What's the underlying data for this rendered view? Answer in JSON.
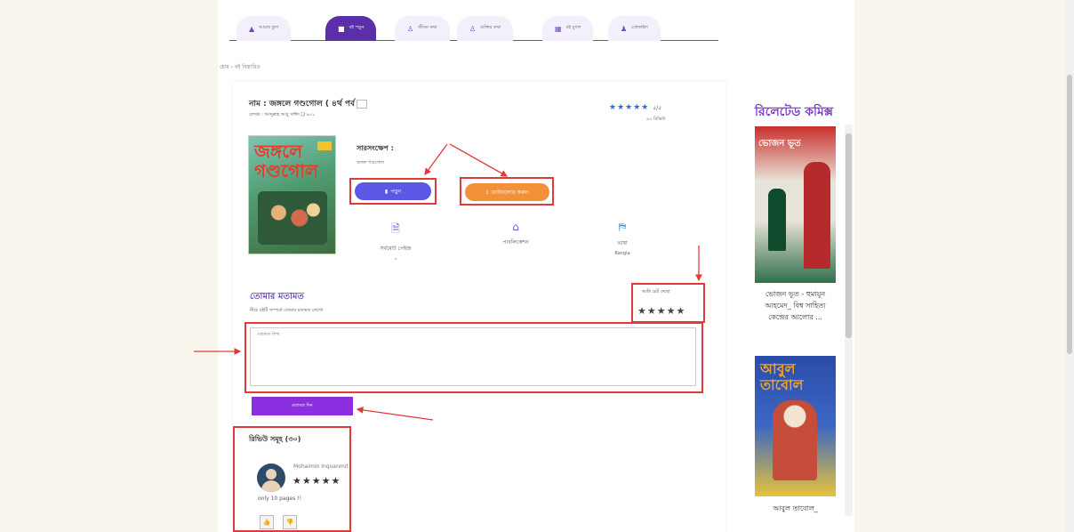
{
  "nav": {
    "tabs": [
      {
        "label": "আমার ঝুল",
        "icon": "home-icon"
      },
      {
        "label": "বই পড়ুন",
        "icon": "book-icon",
        "active": true
      },
      {
        "label": "জীবন কথা",
        "icon": "user-icon"
      },
      {
        "label": "ব্যক্তির কথা",
        "icon": "user-icon"
      },
      {
        "label": "বই যুগল",
        "icon": "grid-icon"
      },
      {
        "label": "প্রোফাইল",
        "icon": "person-icon"
      }
    ]
  },
  "breadcrumb": "হোম › বই বিস্তারিত",
  "book": {
    "title": "নাম : জঙ্গলে গণ্ডগোল ( ৪র্থ পর্ব",
    "writer": "লেখক : আব্দুল্লাহ আবু সাঈদ ❏ ৯০১",
    "rating_stars": "★★★★★",
    "rating_score": "৫/৫",
    "review_count": "৯০ রিভিউ",
    "cover_title": "জঙ্গলে গণ্ডগোল",
    "summary_label": "সারসংক্ষেপ :",
    "summary_text": "জঙ্গল গণ্ডগোল",
    "read_label": "পড়ুন",
    "download_label": "ডাউনলোড করুন",
    "info": [
      {
        "icon": "document-icon",
        "label": "সর্বমোট পেইজ",
        "sub": "০"
      },
      {
        "icon": "publisher-icon",
        "label": "পাবলিকেশন",
        "sub": ""
      },
      {
        "icon": "language-icon",
        "label": "ভাষা",
        "sub": "Bangla"
      }
    ]
  },
  "feedback": {
    "title": "তোমার মতামত",
    "hint": "নীচে বইটি সম্পর্কে তোমার মতামত লেখো",
    "your_rating_label": "আমি রেট দেবো",
    "your_stars": "★★★★★",
    "comment_placeholder": "মতামত লিখ",
    "submit_label": "মতামত দিন"
  },
  "reviews": {
    "title": "রিভিউ সমূহ (৩০)",
    "items": [
      {
        "name": "Mohaimin Inquanmit",
        "stars": "★★★★★",
        "text": "only 10 pages !!"
      }
    ],
    "like_label": "👍",
    "dislike_label": "👎"
  },
  "related": {
    "title": "রিলেটেড কমিক্স",
    "items": [
      {
        "cover_title": "ভোজন ভূত",
        "title": "ভোজন ভূত - হুমায়ূন আহমেদ_ বিশ্ব সাহিত্য কেন্দ্রের আলোর ..."
      },
      {
        "cover_title": "আবুল তাবোল",
        "title": "আবুল তাবোল_"
      }
    ]
  },
  "colors": {
    "accent": "#6b45c7",
    "read_button": "#5c58e6",
    "download_button": "#f2913a",
    "submit_button": "#8b2fe0",
    "annotation": "#e23a3a"
  }
}
